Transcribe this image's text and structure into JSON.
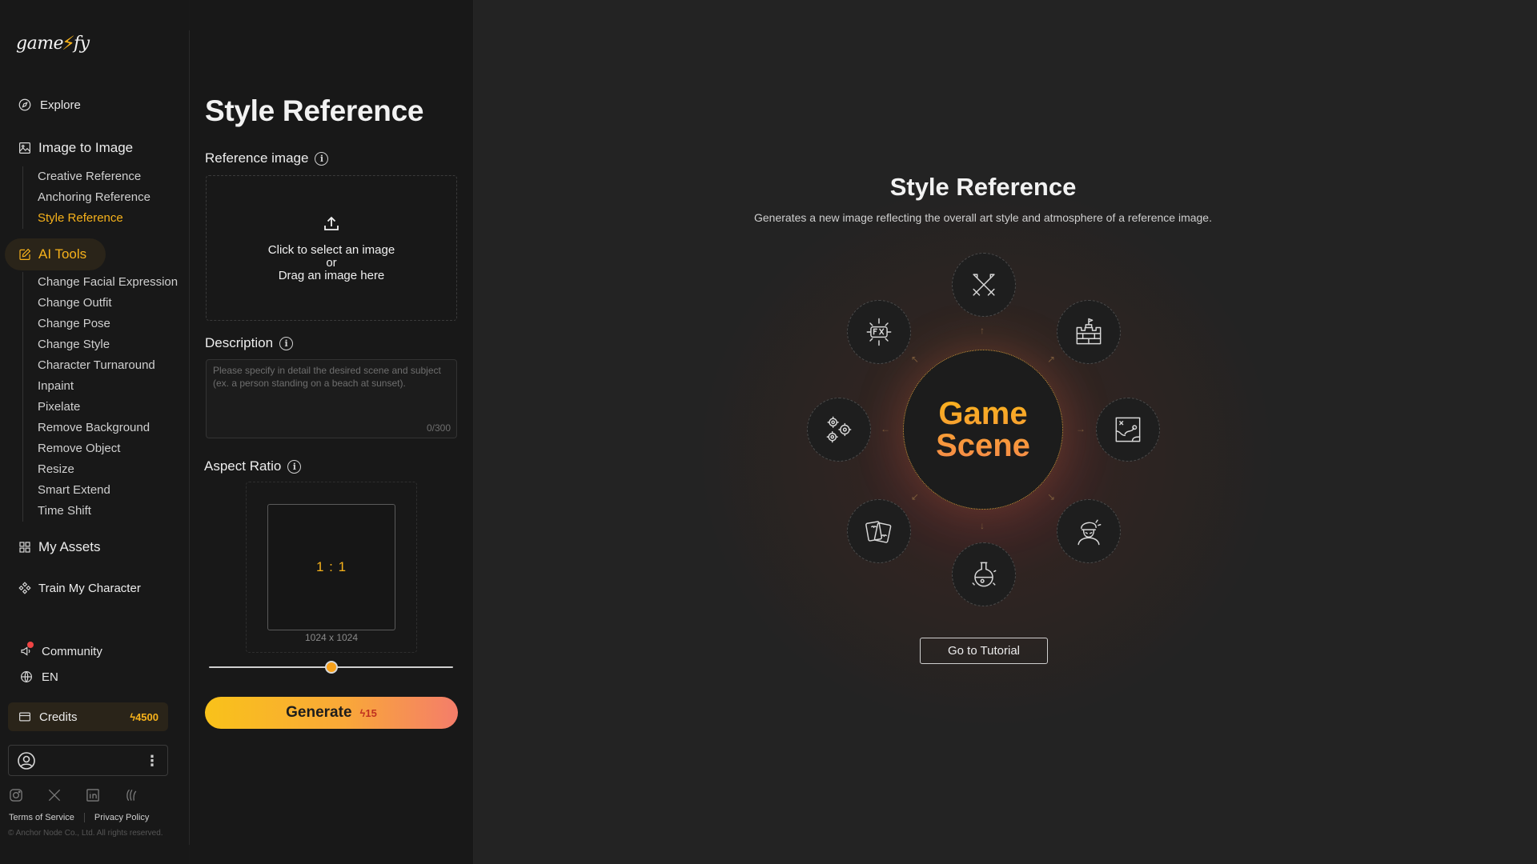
{
  "brand": {
    "logo_text_a": "game",
    "logo_text_b": "fy",
    "logo_mark": "⚡"
  },
  "sidebar": {
    "explore": "Explore",
    "image_to_image": {
      "label": "Image to Image",
      "items": [
        "Creative Reference",
        "Anchoring Reference",
        "Style Reference"
      ],
      "active": "Style Reference"
    },
    "ai_tools": {
      "label": "AI Tools",
      "items": [
        "Change Facial Expression",
        "Change Outfit",
        "Change Pose",
        "Change Style",
        "Character Turnaround",
        "Inpaint",
        "Pixelate",
        "Remove Background",
        "Remove Object",
        "Resize",
        "Smart Extend",
        "Time Shift"
      ]
    },
    "my_assets": "My Assets",
    "train_character": "Train My Character",
    "community": "Community",
    "language": "EN",
    "credits": {
      "label": "Credits",
      "value": "4500",
      "bolt": "ϟ"
    },
    "menu_glyph": "⋮",
    "socials": [
      "instagram-icon",
      "x-icon",
      "linkedin-icon",
      "threads-icon"
    ],
    "terms": "Terms of Service",
    "privacy": "Privacy Policy",
    "copyright": "© Anchor Node Co., Ltd. All rights reserved."
  },
  "form": {
    "title": "Style Reference",
    "reference_label": "Reference image",
    "upload": {
      "line1": "Click to select an image",
      "line2": "or",
      "line3": "Drag an image here"
    },
    "description_label": "Description",
    "description_placeholder": "Please specify in detail the desired scene and subject\n(ex. a person standing on a beach at sunset).",
    "description_count": "0/300",
    "aspect_label": "Aspect Ratio",
    "aspect_value": "1 : 1",
    "aspect_size": "1024 x 1024",
    "slider_fraction": 0.5,
    "generate_label": "Generate",
    "generate_cost": "ϟ15",
    "info_glyph": "i"
  },
  "main": {
    "title": "Style Reference",
    "description": "Generates a new image reflecting the overall art style and atmosphere of a reference image.",
    "hub_line1": "Game",
    "hub_line2": "Scene",
    "nodes": [
      "swords-icon",
      "castle-wall-icon",
      "map-icon",
      "character-icon",
      "potion-icon",
      "cards-icon",
      "gears-icon",
      "fx-icon"
    ],
    "tutorial_label": "Go to Tutorial",
    "accent": "#f7b21b"
  }
}
